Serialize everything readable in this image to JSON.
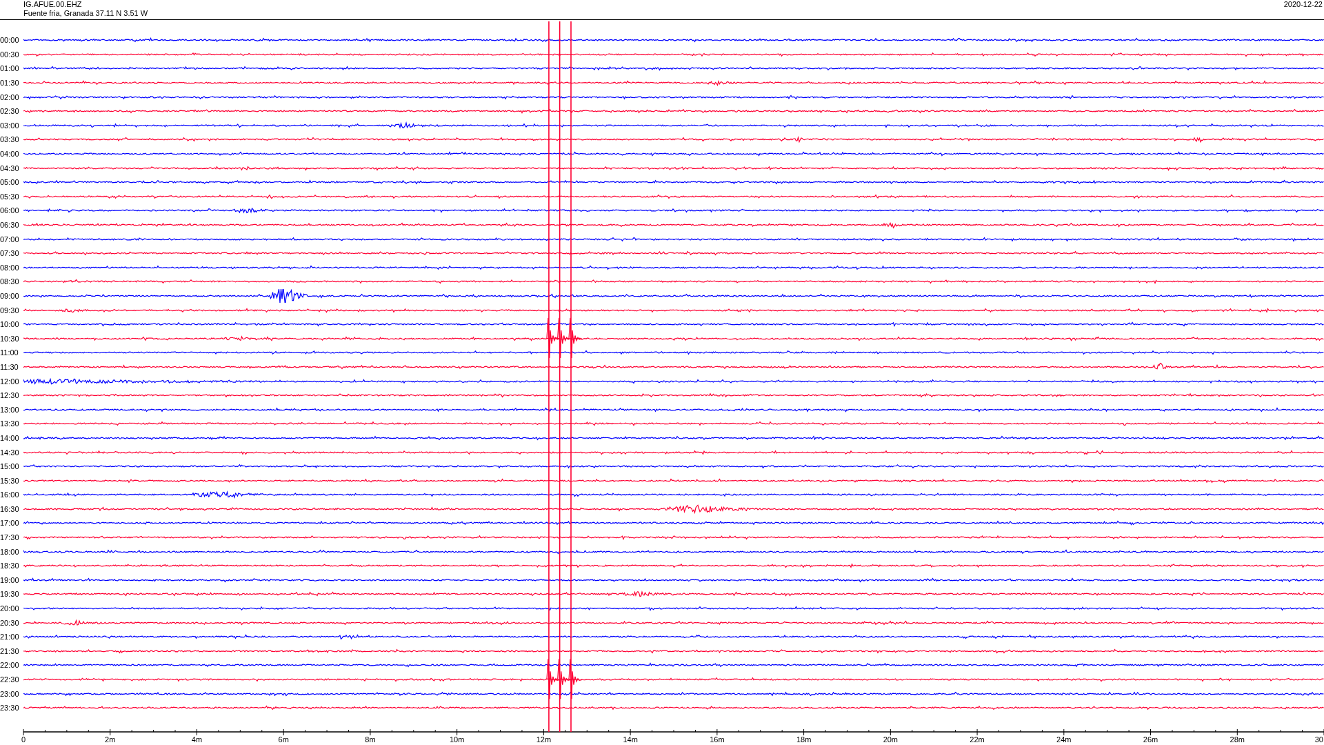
{
  "header": {
    "station": "IG.AFUE.00.EHZ",
    "location": "Fuente fria, Granada  37.11 N 3.51 W",
    "date": "2020-12-22"
  },
  "rows": [
    {
      "label": "00:00",
      "color": "#0000ff"
    },
    {
      "label": "00:30",
      "color": "#ff0033"
    },
    {
      "label": "01:00",
      "color": "#0000ff"
    },
    {
      "label": "01:30",
      "color": "#ff0033"
    },
    {
      "label": "02:00",
      "color": "#0000ff"
    },
    {
      "label": "02:30",
      "color": "#ff0033"
    },
    {
      "label": "03:00",
      "color": "#0000ff"
    },
    {
      "label": "03:30",
      "color": "#ff0033"
    },
    {
      "label": "04:00",
      "color": "#0000ff"
    },
    {
      "label": "04:30",
      "color": "#ff0033"
    },
    {
      "label": "05:00",
      "color": "#0000ff"
    },
    {
      "label": "05:30",
      "color": "#ff0033"
    },
    {
      "label": "06:00",
      "color": "#0000ff"
    },
    {
      "label": "06:30",
      "color": "#ff0033"
    },
    {
      "label": "07:00",
      "color": "#0000ff"
    },
    {
      "label": "07:30",
      "color": "#ff0033"
    },
    {
      "label": "08:00",
      "color": "#0000ff"
    },
    {
      "label": "08:30",
      "color": "#ff0033"
    },
    {
      "label": "09:00",
      "color": "#0000ff"
    },
    {
      "label": "09:30",
      "color": "#ff0033"
    },
    {
      "label": "10:00",
      "color": "#0000ff"
    },
    {
      "label": "10:30",
      "color": "#ff0033"
    },
    {
      "label": "11:00",
      "color": "#0000ff"
    },
    {
      "label": "11:30",
      "color": "#ff0033"
    },
    {
      "label": "12:00",
      "color": "#0000ff"
    },
    {
      "label": "12:30",
      "color": "#ff0033"
    },
    {
      "label": "13:00",
      "color": "#0000ff"
    },
    {
      "label": "13:30",
      "color": "#ff0033"
    },
    {
      "label": "14:00",
      "color": "#0000ff"
    },
    {
      "label": "14:30",
      "color": "#ff0033"
    },
    {
      "label": "15:00",
      "color": "#0000ff"
    },
    {
      "label": "15:30",
      "color": "#ff0033"
    },
    {
      "label": "16:00",
      "color": "#0000ff"
    },
    {
      "label": "16:30",
      "color": "#ff0033"
    },
    {
      "label": "17:00",
      "color": "#0000ff"
    },
    {
      "label": "17:30",
      "color": "#ff0033"
    },
    {
      "label": "18:00",
      "color": "#0000ff"
    },
    {
      "label": "18:30",
      "color": "#ff0033"
    },
    {
      "label": "19:00",
      "color": "#0000ff"
    },
    {
      "label": "19:30",
      "color": "#ff0033"
    },
    {
      "label": "20:00",
      "color": "#0000ff"
    },
    {
      "label": "20:30",
      "color": "#ff0033"
    },
    {
      "label": "21:00",
      "color": "#0000ff"
    },
    {
      "label": "21:30",
      "color": "#ff0033"
    },
    {
      "label": "22:00",
      "color": "#0000ff"
    },
    {
      "label": "22:30",
      "color": "#ff0033"
    },
    {
      "label": "23:00",
      "color": "#0000ff"
    },
    {
      "label": "23:30",
      "color": "#ff0033"
    }
  ],
  "x_axis": {
    "ticks": [
      "0",
      "2m",
      "4m",
      "6m",
      "8m",
      "10m",
      "12m",
      "14m",
      "16m",
      "18m",
      "20m",
      "22m",
      "24m",
      "26m",
      "28m",
      "30"
    ]
  }
}
